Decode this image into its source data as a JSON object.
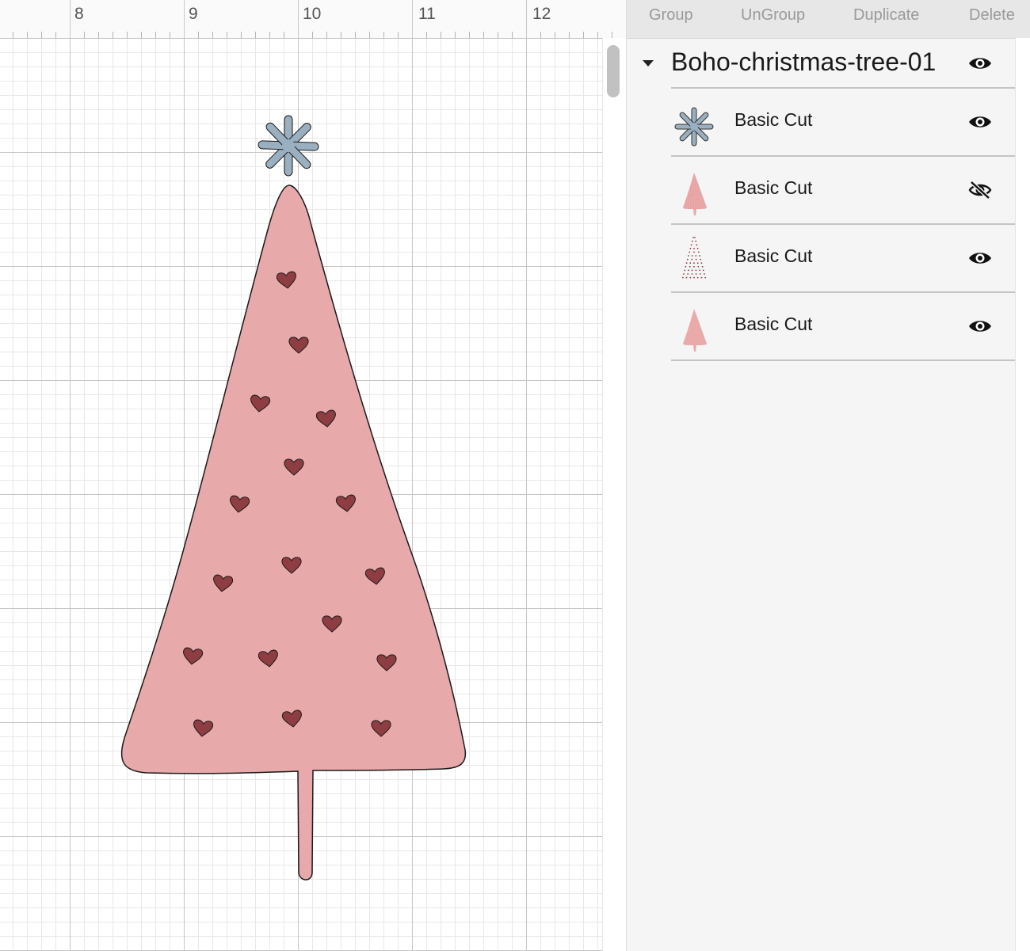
{
  "ruler": {
    "labels": [
      "8",
      "9",
      "10",
      "11",
      "12"
    ]
  },
  "toolbar": {
    "group": "Group",
    "ungroup": "UnGroup",
    "duplicate": "Duplicate",
    "delete": "Delete"
  },
  "layers_panel": {
    "group": {
      "name": "Boho-christmas-tree-01",
      "expanded": true,
      "visible": true
    },
    "layers": [
      {
        "label": "Basic Cut",
        "thumbnail": "snowflake-star",
        "visible": true
      },
      {
        "label": "Basic Cut",
        "thumbnail": "textured-tree",
        "visible": false
      },
      {
        "label": "Basic Cut",
        "thumbnail": "dotted-tree",
        "visible": true
      },
      {
        "label": "Basic Cut",
        "thumbnail": "plain-tree",
        "visible": true
      }
    ]
  },
  "colors": {
    "tree_fill": "#e8a9aa",
    "heart_fill": "#8e3d42",
    "star_fill": "#9aafc0",
    "outline": "#1a1a1a"
  }
}
